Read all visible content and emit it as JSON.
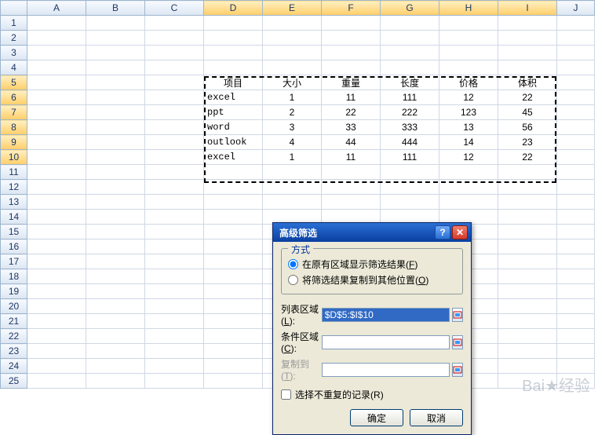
{
  "columns": [
    "A",
    "B",
    "C",
    "D",
    "E",
    "F",
    "G",
    "H",
    "I",
    "J"
  ],
  "rowCount": 25,
  "selectedColumns": [
    "D",
    "E",
    "F",
    "G",
    "H",
    "I"
  ],
  "selectedRows": [
    5,
    6,
    7,
    8,
    9,
    10
  ],
  "table": {
    "headers": [
      "项目",
      "大小",
      "重量",
      "长度",
      "价格",
      "体积"
    ],
    "rows": [
      [
        "excel",
        "1",
        "11",
        "111",
        "12",
        "22"
      ],
      [
        "ppt",
        "2",
        "22",
        "222",
        "123",
        "45"
      ],
      [
        "word",
        "3",
        "33",
        "333",
        "13",
        "56"
      ],
      [
        "outlook",
        "4",
        "44",
        "444",
        "14",
        "23"
      ],
      [
        "excel",
        "1",
        "11",
        "111",
        "12",
        "22"
      ]
    ],
    "startCol": "D",
    "startRow": 5
  },
  "dialog": {
    "title": "高级筛选",
    "mode_legend": "方式",
    "radio1": "在原有区域显示筛选结果",
    "radio1_hk": "F",
    "radio2": "将筛选结果复制到其他位置",
    "radio2_hk": "O",
    "radio_selected": 1,
    "list_label": "列表区域",
    "list_hk": "L",
    "list_value": "$D$5:$I$10",
    "cond_label": "条件区域",
    "cond_hk": "C",
    "cond_value": "",
    "copy_label": "复制到",
    "copy_hk": "T",
    "copy_value": "",
    "unique_label": "选择不重复的记录",
    "unique_hk": "R",
    "unique_checked": false,
    "ok": "确定",
    "cancel": "取消"
  },
  "watermark": "Bai★经验"
}
